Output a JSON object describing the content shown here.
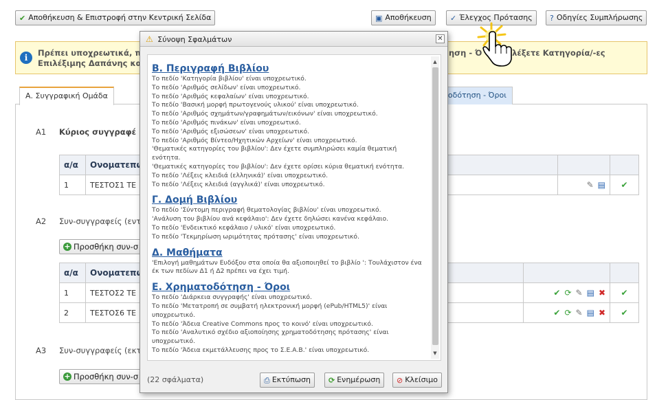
{
  "toolbar": {
    "save_return_label": "Αποθήκευση & Επιστροφή στην Κεντρική Σελίδα",
    "save_label": "Αποθήκευση",
    "check_label": "Έλεγχος Πρότασης",
    "guide_label": "Οδηγίες Συμπλήρωσης"
  },
  "info": {
    "line1": "Πρέπει υποχρεωτικά, π",
    "line2": "Επιλέξιμης Δαπάνης κα",
    "right": "ηση - Ό      να επιλέξετε Κατηγορία/-ες"
  },
  "tabs": [
    {
      "label": "Α. Συγγραφική Ομάδα"
    },
    {
      "label": "ματοδότηση - Όροι"
    }
  ],
  "main": {
    "a1": {
      "code": "Α1",
      "title": "Κύριος συγγραφέ"
    },
    "a2": {
      "code": "Α2",
      "title": "Συν-συγγραφείς (εντ"
    },
    "a3": {
      "code": "Α3",
      "title": "Συν-συγγραφείς (εκτ"
    },
    "add_coauthor_label": "Προσθήκη συν-σ",
    "add_coauthor_label2": "Προσθήκη συν-σ",
    "table_headers": [
      "α/α",
      "Ονοματεπώ"
    ],
    "table1_rows": [
      {
        "num": "1",
        "name": "ΤΕΣΤΟΣ1 ΤΕ"
      }
    ],
    "table2_rows": [
      {
        "num": "1",
        "name": "ΤΕΣΤΟΣ2 ΤΕ"
      },
      {
        "num": "2",
        "name": "ΤΕΣΤΟΣ6 ΤΕ"
      }
    ]
  },
  "dialog": {
    "title": "Σύνοψη Σφαλμάτων",
    "sections": [
      {
        "heading": "Β. Περιγραφή Βιβλίου",
        "errors": [
          "Το πεδίο 'Κατηγορία βιβλίου' είναι υποχρεωτικό.",
          "Το πεδίο 'Αριθμός σελίδων' είναι υποχρεωτικό.",
          "Το πεδίο 'Αριθμός κεφαλαίων' είναι υποχρεωτικό.",
          "Το πεδίο 'Βασική μορφή πρωτογενούς υλικού' είναι υποχρεωτικό.",
          "Το πεδίο 'Αριθμός σχημάτων/γραφημάτων/εικόνων' είναι υποχρεωτικό.",
          "Το πεδίο 'Αριθμός πινάκων' είναι υποχρεωτικό.",
          "Το πεδίο 'Αριθμός εξισώσεων' είναι υποχρεωτικό.",
          "Το πεδίο 'Αριθμός Βίντεο/Ηχητικών Αρχείων' είναι υποχρεωτικό.",
          "'Θεματικές κατηγορίες του βιβλίου': Δεν έχετε συμπληρώσει καμία θεματική ενότητα.",
          "'Θεματικές κατηγορίες του βιβλίου': Δεν έχετε ορίσει κύρια θεματική ενότητα.",
          "Το πεδίο 'Λέξεις κλειδιά (ελληνικά)' είναι υποχρεωτικό.",
          "Το πεδίο 'Λέξεις κλειδιά (αγγλικά)' είναι υποχρεωτικό."
        ]
      },
      {
        "heading": "Γ. Δομή Βιβλίου",
        "errors": [
          "Το πεδίο 'Σύντομη περιγραφή θεματολογίας βιβλίου' είναι υποχρεωτικό.",
          "'Ανάλυση του βιβλίου ανά κεφάλαιο': Δεν έχετε δηλώσει κανένα κεφάλαιο.",
          "Το πεδίο 'Ενδεικτικό κεφάλαιο / υλικό' είναι υποχρεωτικό.",
          "Το πεδίο 'Τεκμηρίωση ωριμότητας πρότασης' είναι υποχρεωτικό."
        ]
      },
      {
        "heading": "Δ. Μαθήματα",
        "errors": [
          "'Επιλογή μαθημάτων Ευδόξου στα οποία θα αξιοποιηθεί το βιβλίο ': Τουλάχιστον ένα έκ των πεδίων Δ1 ή Δ2 πρέπει να έχει τιμή."
        ]
      },
      {
        "heading": "Ε. Χρηματοδότηση - Όροι",
        "errors": [
          "Το πεδίο 'Διάρκεια συγγραφής' είναι υποχρεωτικό.",
          "Το πεδίο 'Μετατροπή σε συμβατή ηλεκτρονική μορφή (ePub/HTML5)' είναι υποχρεωτικό.",
          "Το πεδίο 'Άδεια Creative Commons προς το κοινό' είναι υποχρεωτικό.",
          "Το πεδίο 'Αναλυτικό σχέδιο αξιοποίησης χρηματοδότησης πρότασης' είναι υποχρεωτικό.",
          "Το πεδίο 'Άδεια εκμετάλλευσης προς το Σ.Ε.Α.Β.' είναι υποχρεωτικό."
        ]
      }
    ],
    "error_count": "(22 σφάλματα)",
    "print_label": "Εκτύπωση",
    "update_label": "Ενημέρωση",
    "close_label": "Κλείσιμο"
  }
}
